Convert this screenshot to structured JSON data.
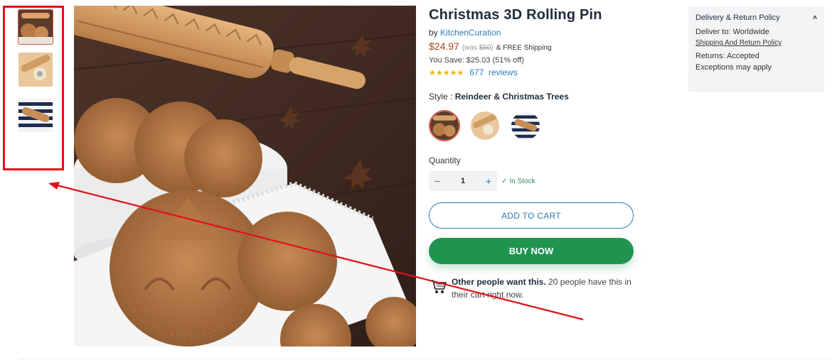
{
  "product": {
    "title": "Christmas 3D Rolling Pin",
    "by_prefix": "by",
    "vendor": "KitchenCuration",
    "price": "$24.97",
    "was_prefix": "(was",
    "was_price": "$50",
    "was_suffix": ")",
    "shipping": "& FREE Shipping",
    "savings": "You Save: $25.03 (51% off)",
    "stars": "★★★★★",
    "rating_count": "677",
    "rating_label": "reviews"
  },
  "style": {
    "label": "Style :",
    "selected": "Reindeer & Christmas Trees"
  },
  "quantity": {
    "label": "Quantity",
    "value": "1",
    "minus": "−",
    "plus": "+",
    "stock_icon": "✓",
    "stock": "In Stock"
  },
  "buttons": {
    "add_to_cart": "ADD TO CART",
    "buy_now": "BUY NOW"
  },
  "social": {
    "bold": "Other people want this.",
    "text": "20 people have this in their cart right now."
  },
  "delivery": {
    "heading": "Delivery & Return Policy",
    "chevron": "˄",
    "deliver_label": "Deliver to:",
    "deliver_value": "Worldwide",
    "policy_link": "Shipping And Return Policy",
    "returns_label": "Returns:",
    "returns_value": "Accepted",
    "exceptions": "Exceptions may apply"
  },
  "colors": {
    "accent_red": "#e3101a",
    "link_blue": "#2f7bb5",
    "buy_green": "#1e9450",
    "price": "#a0441a",
    "star": "#f0b400"
  }
}
